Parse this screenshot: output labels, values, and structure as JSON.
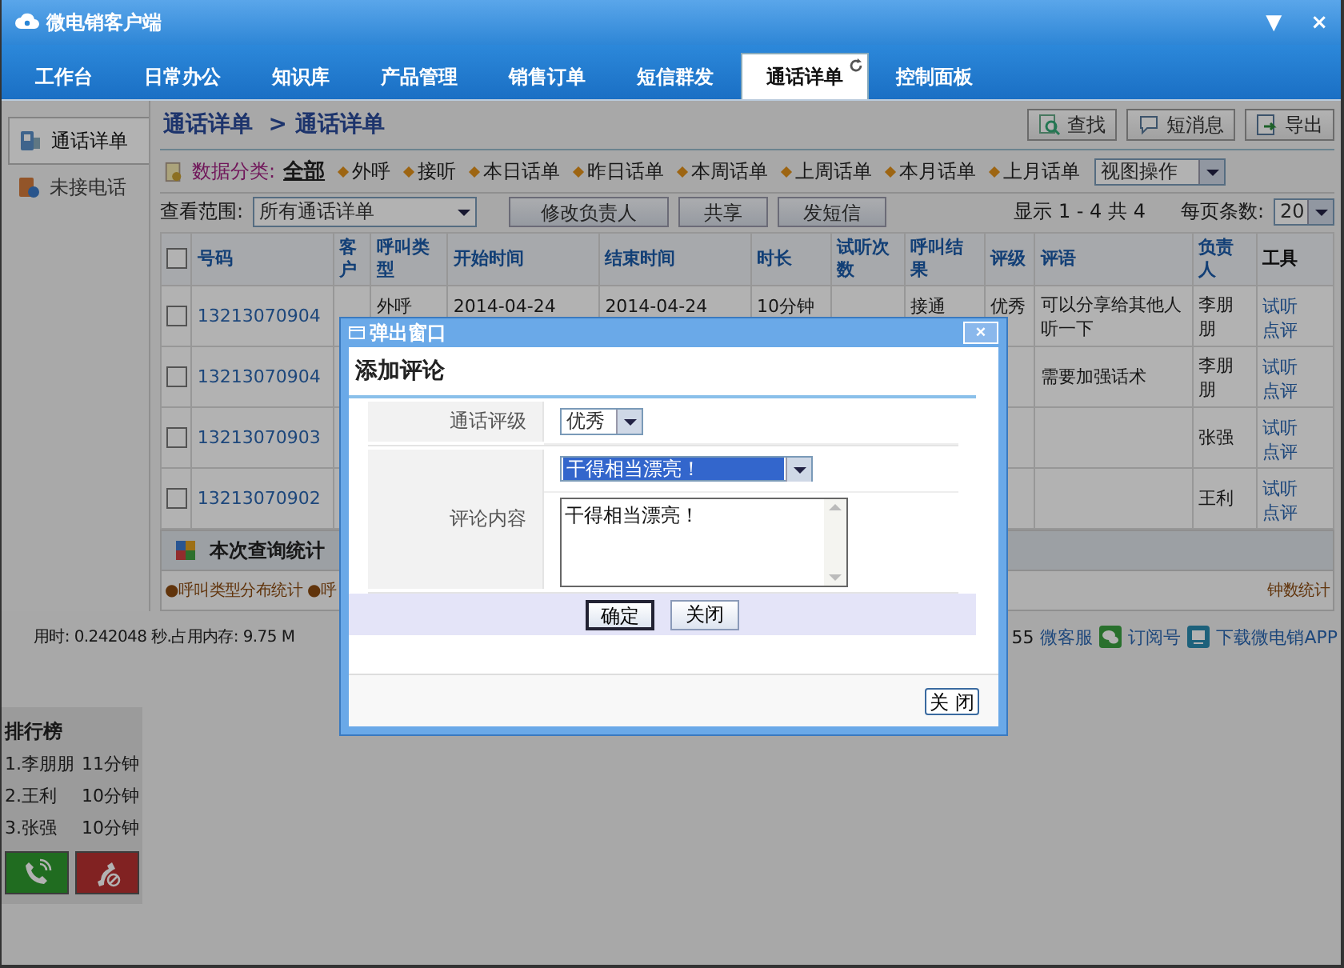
{
  "window": {
    "title": "微电销客户端",
    "controls": [
      "▼",
      "×"
    ]
  },
  "nav_tabs": [
    {
      "label": "工作台",
      "selected": false
    },
    {
      "label": "日常办公",
      "selected": false
    },
    {
      "label": "知识库",
      "selected": false
    },
    {
      "label": "产品管理",
      "selected": false
    },
    {
      "label": "销售订单",
      "selected": false
    },
    {
      "label": "短信群发",
      "selected": false
    },
    {
      "label": "通话详单",
      "selected": true
    },
    {
      "label": "控制面板",
      "selected": false
    }
  ],
  "sidebar": {
    "items": [
      {
        "label": "通话详单",
        "selected": true
      },
      {
        "label": "未接电话",
        "selected": false
      }
    ]
  },
  "breadcrumb": [
    "通话详单",
    "> 通话详单"
  ],
  "toolbar_buttons": [
    "查找",
    "短消息",
    "导出"
  ],
  "filter": {
    "label": "数据分类:",
    "items": [
      {
        "label": "全部",
        "selected": true
      },
      {
        "label": "外呼",
        "selected": false
      },
      {
        "label": "接听",
        "selected": false
      },
      {
        "label": "本日话单",
        "selected": false
      },
      {
        "label": "昨日话单",
        "selected": false
      },
      {
        "label": "本周话单",
        "selected": false
      },
      {
        "label": "上周话单",
        "selected": false
      },
      {
        "label": "本月话单",
        "selected": false
      },
      {
        "label": "上月话单",
        "selected": false
      }
    ],
    "view_select": "视图操作"
  },
  "range": {
    "label": "查看范围:",
    "value": "所有通话详单",
    "buttons": [
      "修改负责人",
      "共享",
      "发短信"
    ],
    "paging": "显示 1 - 4 共 4",
    "page_size_label": "每页条数:",
    "page_size": "20"
  },
  "table": {
    "select_all_checked": false,
    "columns": [
      "号码",
      "客户",
      "呼叫类型",
      "开始时间",
      "结束时间",
      "时长",
      "试听次数",
      "呼叫结果",
      "评级",
      "评语",
      "负责人",
      "工具"
    ],
    "rows": [
      {
        "checked": false,
        "number": "13213070904",
        "call_type": "外呼",
        "start": "2014-04-24",
        "end": "2014-04-24",
        "duration": "10分钟",
        "result": "接通",
        "rating": "优秀",
        "comment": "可以分享给其他人听一下",
        "owner": "李朋朋",
        "tools": [
          "试听",
          "点评"
        ]
      },
      {
        "checked": false,
        "number": "13213070904",
        "comment": "需要加强话术",
        "owner": "李朋朋",
        "tools": [
          "试听",
          "点评"
        ]
      },
      {
        "checked": false,
        "number": "13213070903",
        "owner": "张强",
        "tools": [
          "试听",
          "点评"
        ]
      },
      {
        "checked": false,
        "number": "13213070902",
        "owner": "王利",
        "tools": [
          "试听",
          "点评"
        ]
      }
    ]
  },
  "stats": {
    "title": "本次查询统计",
    "items": [
      "●呼叫类型分布统计",
      "●呼"
    ],
    "tail": "钟数统计"
  },
  "footer": {
    "timing": "用时: 0.242048 秒.占用内存: 9.75 M",
    "count": "55",
    "links": [
      "微客服",
      "订阅号",
      "下载微电销APP"
    ]
  },
  "ranking": {
    "title": "排行榜",
    "entries": [
      {
        "name": "1.李朋朋",
        "time": "11分钟"
      },
      {
        "name": "2.王利",
        "time": "10分钟"
      },
      {
        "name": "3.张强",
        "time": "10分钟"
      }
    ]
  },
  "popup": {
    "title": "弹出窗口",
    "close": "×",
    "heading": "添加评论",
    "fields": [
      {
        "kind": "select",
        "label": "通话评级",
        "value": "优秀"
      },
      {
        "kind": "comment",
        "label": "评论内容",
        "preset": "干得相当漂亮！",
        "value": "干得相当漂亮！"
      }
    ],
    "buttons": [
      "确定",
      "关闭"
    ],
    "footer_button": "关 闭"
  }
}
